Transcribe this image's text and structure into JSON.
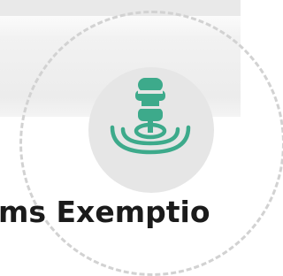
{
  "card": {
    "title": "ms Exemptio",
    "icon": "push-pin-target-icon",
    "colors": {
      "accent": "#3daa8b",
      "icon_background": "#e6e6e6",
      "ring": "#d2d2d2",
      "title": "#1b1b1b"
    }
  }
}
